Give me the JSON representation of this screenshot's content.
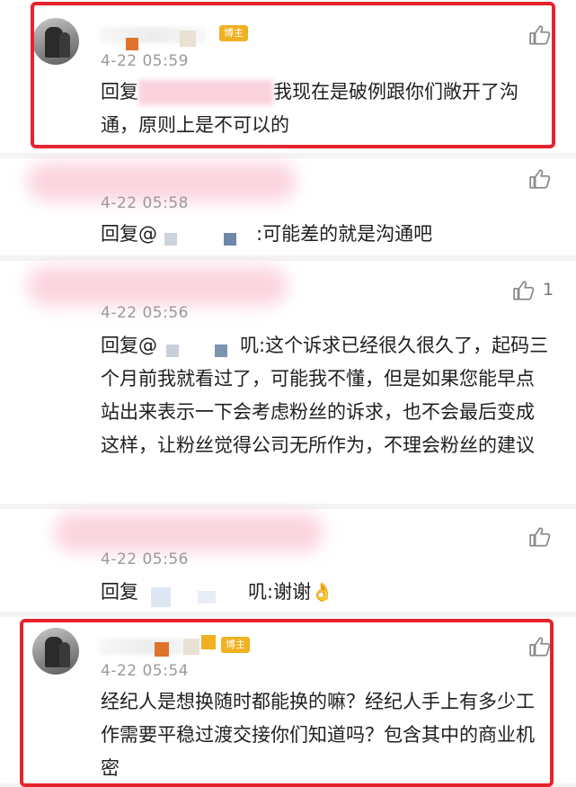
{
  "comments": [
    {
      "time": "4-22 05:59",
      "badge": "博主",
      "reply_prefix": "回复",
      "text": "我现在是破例跟你们敞开了沟通，原则上是不可以的",
      "likes": ""
    },
    {
      "time": "4-22 05:58",
      "reply_prefix": "回复@",
      "text": ":可能差的就是沟通吧",
      "likes": ""
    },
    {
      "time": "4-22 05:56",
      "reply_prefix": "回复@",
      "mention_tail": "叽",
      "text": ":这个诉求已经很久很久了，起码三个月前我就看过了，可能我不懂，但是如果您能早点站出来表示一下会考虑粉丝的诉求，也不会最后变成这样，让粉丝觉得公司无所作为，不理会粉丝的建议",
      "likes": "1"
    },
    {
      "time": "4-22 05:56",
      "reply_prefix": "回复",
      "mention_tail": "叽",
      "text": ":谢谢",
      "emoji": "👌",
      "likes": ""
    },
    {
      "time": "4-22 05:54",
      "badge": "博主",
      "reply_prefix": "",
      "text": "经纪人是想换随时都能换的嘛？经纪人手上有多少工作需要平稳过渡交接你们知道吗？包含其中的商业机密",
      "likes": ""
    }
  ],
  "colors": {
    "highlight_box": "#e8222c",
    "badge": "#f0b020",
    "time": "#9a9a9a",
    "redaction_pink": "#fbd3de"
  },
  "icons": {
    "like": "thumbs-up-icon",
    "avatar": "user-avatar",
    "emoji": "ok-hand-emoji"
  }
}
